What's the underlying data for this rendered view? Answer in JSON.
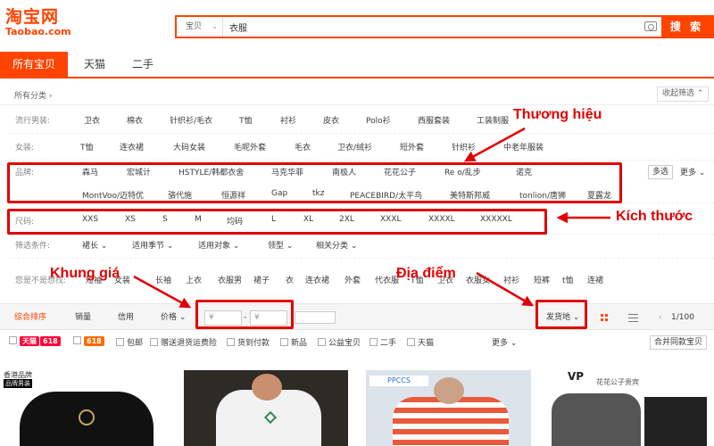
{
  "header": {
    "logo_main": "淘宝网",
    "logo_sub": "Taobao.com",
    "search_category": "宝贝",
    "search_value": "衣服",
    "search_button": "搜 索"
  },
  "tabs": [
    "所有宝贝",
    "天猫",
    "二手"
  ],
  "crumb": "所有分类 ›",
  "collapse_label": "收起筛选",
  "rows": {
    "popular": {
      "label": "流行男装:",
      "items": [
        "卫衣",
        "棉衣",
        "针织衫/毛衣",
        "T恤",
        "衬衫",
        "皮衣",
        "Polo衫",
        "西服套装",
        "工装制服"
      ]
    },
    "women": {
      "label": "女装:",
      "items": [
        "T恤",
        "连衣裙",
        "大码女装",
        "毛呢外套",
        "毛衣",
        "卫衣/绒衫",
        "短外套",
        "针织衫",
        "中老年服装"
      ]
    },
    "brand": {
      "label": "品牌:",
      "row1": [
        "森马",
        "宏城计",
        "HSTYLE/韩都衣舍",
        "马克华菲",
        "南极人",
        "花花公子",
        "Re   o/乱步",
        "诺克"
      ],
      "row2": [
        "MontVoo/迈特优",
        "骆代施",
        "恒源祥",
        "Gap",
        "tkz",
        "PEACEBIRD/太平鸟",
        "美特斯邦威",
        "tonlion/唐狮",
        "夏露龙"
      ],
      "multi_label": "多选",
      "more_label": "更多"
    },
    "size": {
      "label": "尺码:",
      "items": [
        "XXS",
        "XS",
        "S",
        "M",
        "均码",
        "L",
        "XL",
        "2XL",
        "XXXL",
        "XXXXL",
        "XXXXXL"
      ]
    },
    "filter": {
      "label": "筛选条件:",
      "items": [
        "裙长",
        "适用季节",
        "适用对象",
        "领型",
        "相关分类"
      ]
    },
    "related": {
      "label": "您是不是想找:",
      "items": [
        "短袖",
        "女装",
        "长袖",
        "上衣",
        "衣服男",
        "裙子",
        "衣",
        "连衣裙",
        "外套",
        "代衣服",
        "T恤",
        "卫衣",
        "衣服女",
        "衬衫",
        "短裤",
        "t恤",
        "连裙"
      ]
    }
  },
  "sortbar": {
    "tabs": [
      "综合排序",
      "销量",
      "信用",
      "价格"
    ],
    "price_from": "¥",
    "price_sep": "-",
    "price_to": "¥",
    "location": "发货地",
    "page": "1/100",
    "prev": "‹"
  },
  "options": {
    "tmall": "天猫",
    "tmall_num": "618",
    "badge618": "618",
    "items": [
      "包邮",
      "赠送退货运费险",
      "货到付款",
      "新品",
      "公益宝贝",
      "二手",
      "天猫"
    ],
    "more": "更多",
    "merge": "合并同款宝贝"
  },
  "products": [
    {
      "tag": "香港品牌",
      "tag2": "品牌男装",
      "color": "#111111"
    },
    {
      "color": "#f2f2f2"
    },
    {
      "tag": "PPCCS",
      "color": "#e85a3a"
    },
    {
      "tag": "VP",
      "tag2": "花花公子贵宾",
      "color": "#555555"
    }
  ],
  "annotations": {
    "brand": "Thương hiệu",
    "size": "Kích thước",
    "price": "Khung giá",
    "location": "Địa điểm"
  },
  "colors": {
    "accent": "#ff4400",
    "annotation": "#e00000"
  }
}
